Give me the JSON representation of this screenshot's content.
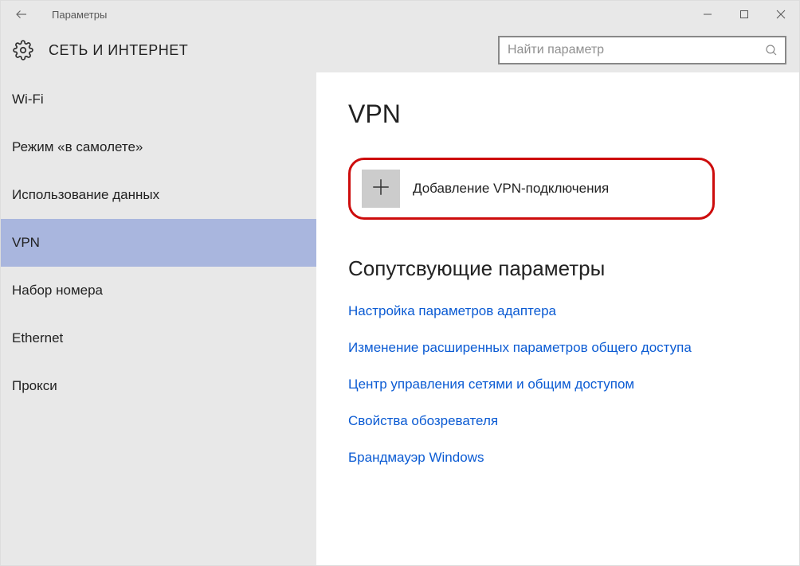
{
  "window": {
    "title": "Параметры"
  },
  "header": {
    "category": "СЕТЬ И ИНТЕРНЕТ",
    "search_placeholder": "Найти параметр"
  },
  "sidebar": {
    "items": [
      {
        "label": "Wi-Fi"
      },
      {
        "label": "Режим «в самолете»"
      },
      {
        "label": "Использование данных"
      },
      {
        "label": "VPN"
      },
      {
        "label": "Набор номера"
      },
      {
        "label": "Ethernet"
      },
      {
        "label": "Прокси"
      }
    ],
    "selected_index": 3
  },
  "main": {
    "page_title": "VPN",
    "add_vpn_label": "Добавление VPN-подключения",
    "related_section_title": "Сопутсвующие параметры",
    "links": [
      {
        "label": "Настройка параметров адаптера"
      },
      {
        "label": "Изменение расширенных параметров общего доступа"
      },
      {
        "label": "Центр управления сетями и общим доступом"
      },
      {
        "label": "Свойства обозревателя"
      },
      {
        "label": "Брандмауэр Windows"
      }
    ]
  }
}
